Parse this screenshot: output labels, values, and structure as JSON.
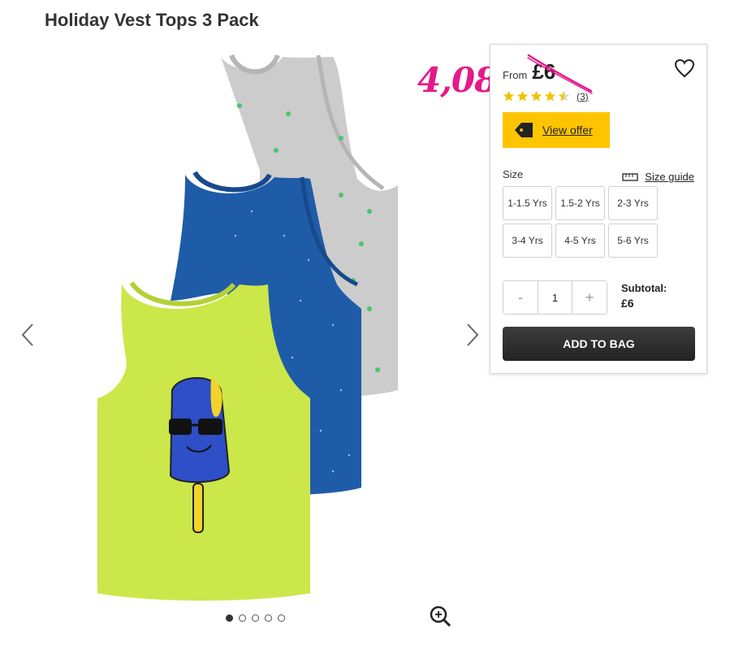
{
  "product": {
    "title": "Holiday Vest Tops 3 Pack"
  },
  "annotation": {
    "handwritten_price": "4,08",
    "color": "#e6198a"
  },
  "buybox": {
    "from_label": "From",
    "price": "£6",
    "rating": {
      "stars": 4.5,
      "max": 5,
      "count": "(3)"
    },
    "offer_label": "View offer",
    "size_label": "Size",
    "size_guide_label": "Size guide",
    "sizes": [
      "1-1.5 Yrs",
      "1.5-2 Yrs",
      "2-3 Yrs",
      "3-4 Yrs",
      "4-5 Yrs",
      "5-6 Yrs"
    ],
    "quantity": {
      "minus": "-",
      "value": "1",
      "plus": "+"
    },
    "subtotal_label": "Subtotal:",
    "subtotal_value": "£6",
    "add_to_bag_label": "ADD TO BAG"
  },
  "gallery": {
    "dots": 5,
    "active_dot": 1
  },
  "colors": {
    "offer_yellow": "#ffc400",
    "star_yellow": "#f2c200",
    "button_dark": "#222222",
    "vest_green": "#cbe74a",
    "vest_blue": "#1f5ca8",
    "vest_grey": "#cccccc"
  },
  "icons": [
    "chevron-left-icon",
    "chevron-right-icon",
    "heart-icon",
    "star-icon",
    "price-tag-icon",
    "ruler-icon",
    "zoom-in-icon"
  ]
}
